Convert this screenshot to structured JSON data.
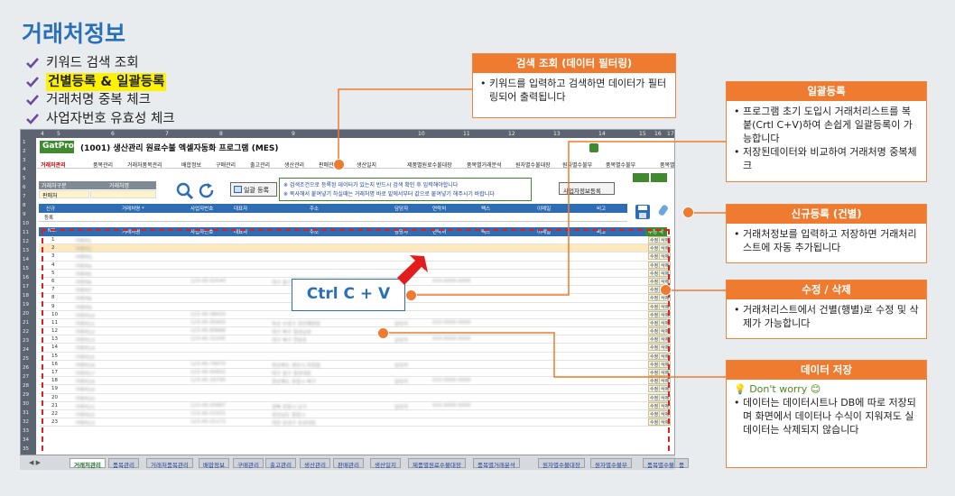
{
  "page": {
    "title": "거래처정보",
    "features": [
      {
        "label": "키워드 검색 조회",
        "highlight": false
      },
      {
        "label": "건별등록 & 일괄등록",
        "highlight": true
      },
      {
        "label": "거래처명 중복 체크",
        "highlight": false
      },
      {
        "label": "사업자번호 유효성 체크",
        "highlight": false
      }
    ]
  },
  "sheet": {
    "logo": "GatPro",
    "program_title": "(1001) 생산관리 원료수불 엑셀자동화 프로그램 (MES)",
    "col_headers": [
      "4",
      "5",
      "6",
      "7",
      "8",
      "9",
      "10",
      "11",
      "12",
      "13",
      "14",
      "15",
      "16",
      "17"
    ],
    "menu": [
      "거래처관리",
      "품목관리",
      "거래처품목관리",
      "배합정보",
      "구매관리",
      "출고관리",
      "생산관리",
      "판매관리",
      "생산일지",
      "제품별원료수불대장",
      "품목별거래분석",
      "원자별수불대장",
      "원자별수불부",
      "품목별수불부",
      "품목별"
    ],
    "search": {
      "label": "거래처구분",
      "label2": "거래처명",
      "value": "판매처"
    },
    "bulk_button": "일괄 등록",
    "notice": [
      "※ 검색조건으로 등록된 데이터가 있는지 반드시 검색 확인 후 입력해야합니다",
      "※ 복사해서 붙여넣기 하실때는 거래처명 바로 밑에서부터 값으로 붙여넣기 해주시기 바랍니다"
    ],
    "check_button": "사업자정보등록",
    "input_headers": [
      "신규",
      "거래처명 *",
      "사업자번호",
      "대표자",
      "주소",
      "담당자",
      "연락처",
      "팩스",
      "이메일",
      "비고"
    ],
    "input_row_label": "등록",
    "grid_headers": [
      "NO.",
      "거래처명",
      "사업자번호",
      "대표자",
      "주소",
      "담당자",
      "연락처",
      "팩스",
      "이메일",
      "비고",
      "수정",
      "삭제"
    ],
    "rows": [
      {
        "no": "1",
        "name": "거래처1",
        "biz": "",
        "rep": "",
        "addr": "",
        "mgr": "",
        "tel": ""
      },
      {
        "no": "2",
        "name": "거래처2",
        "biz": "",
        "rep": "",
        "addr": "",
        "mgr": "",
        "tel": ""
      },
      {
        "no": "3",
        "name": "거래처3",
        "biz": "",
        "rep": "",
        "addr": "",
        "mgr": "",
        "tel": ""
      },
      {
        "no": "4",
        "name": "거래처4",
        "biz": "",
        "rep": "",
        "addr": "",
        "mgr": "",
        "tel": ""
      },
      {
        "no": "5",
        "name": "거래처5",
        "biz": "",
        "rep": "",
        "addr": "",
        "mgr": "",
        "tel": ""
      },
      {
        "no": "6",
        "name": "거래처6",
        "biz": "123-45-02540",
        "rep": "",
        "addr": "대구 중구 동성로",
        "mgr": "",
        "tel": "010-0000-0000"
      },
      {
        "no": "7",
        "name": "거래처7",
        "biz": "",
        "rep": "",
        "addr": "",
        "mgr": "",
        "tel": ""
      },
      {
        "no": "8",
        "name": "거래처8",
        "biz": "",
        "rep": "",
        "addr": "",
        "mgr": "",
        "tel": ""
      },
      {
        "no": "9",
        "name": "거래처9",
        "biz": "",
        "rep": "",
        "addr": "",
        "mgr": "",
        "tel": ""
      },
      {
        "no": "10",
        "name": "거래처10",
        "biz": "123-45-08420",
        "rep": "",
        "addr": "",
        "mgr": "",
        "tel": ""
      },
      {
        "no": "11",
        "name": "거래처11",
        "biz": "123-45-00455",
        "rep": "",
        "addr": "부산 수영구 광안해변로",
        "mgr": "담당자",
        "tel": "010-0000-0000"
      },
      {
        "no": "12",
        "name": "거래처12",
        "biz": "123-45-89888",
        "rep": "",
        "addr": "대구 북구 칠성남로",
        "mgr": "",
        "tel": ""
      },
      {
        "no": "13",
        "name": "거래처13",
        "biz": "123-45-32245",
        "rep": "",
        "addr": "대구 북구 연암로",
        "mgr": "담당자",
        "tel": "010-0000-0000"
      },
      {
        "no": "14",
        "name": "거래처14",
        "biz": "",
        "rep": "",
        "addr": "",
        "mgr": "",
        "tel": ""
      },
      {
        "no": "15",
        "name": "거래처15",
        "biz": "",
        "rep": "",
        "addr": "",
        "mgr": "",
        "tel": ""
      },
      {
        "no": "16",
        "name": "거래처16",
        "biz": "123-45-79070",
        "rep": "",
        "addr": "경상북도 경산시 하양읍",
        "mgr": "담당자",
        "tel": ""
      },
      {
        "no": "17",
        "name": "거래처17",
        "biz": "123-45-00832",
        "rep": "",
        "addr": "대구 중구 중앙대로",
        "mgr": "",
        "tel": ""
      },
      {
        "no": "18",
        "name": "거래처18",
        "biz": "123-45-16745",
        "rep": "",
        "addr": "경상북도 포항시 북구",
        "mgr": "담당자",
        "tel": "010-0000-0000"
      },
      {
        "no": "19",
        "name": "거래처19",
        "biz": "",
        "rep": "",
        "addr": "",
        "mgr": "",
        "tel": ""
      },
      {
        "no": "20",
        "name": "거래처20",
        "biz": "",
        "rep": "",
        "addr": "",
        "mgr": "",
        "tel": ""
      },
      {
        "no": "21",
        "name": "거래처21",
        "biz": "123-45-00887",
        "rep": "",
        "addr": "경북 포항시 남구",
        "mgr": "담당자",
        "tel": "010-0000-0000"
      },
      {
        "no": "22",
        "name": "거래처22",
        "biz": "123-45-01501",
        "rep": "",
        "addr": "경상남도 창원시",
        "mgr": "",
        "tel": ""
      },
      {
        "no": "23",
        "name": "거래처23",
        "biz": "123-45-01172",
        "rep": "",
        "addr": "대전 유성구 유성대로",
        "mgr": "",
        "tel": ""
      }
    ],
    "edit_label": "수정",
    "delete_label": "삭제",
    "tabs": [
      "거래처관리",
      "품목관리",
      "거래처품목관리",
      "배합정보",
      "구매관리",
      "출고관리",
      "생산관리",
      "판매관리",
      "생산일지",
      "제품별원료수불대장",
      "품목별거래분석",
      "원자별수불대장",
      "원자별수불부",
      "품목별수불부",
      "품"
    ],
    "active_tab": 0
  },
  "overlay": {
    "ctrlcv": "Ctrl C + V"
  },
  "callouts": {
    "search": {
      "title": "검색 조회 (데이터 필터링)",
      "items": [
        "키워드를 입력하고 검색하면 데이터가 필터링되어 출력됩니다"
      ]
    },
    "bulk": {
      "title": "일괄등록",
      "items": [
        "프로그램 초기 도입시 거래처리스트를 복붙(Crtl C+V)하여 손쉽게 일괄등록이 가능합니다",
        "저장된데이터와 비교하여 거래처명 중복체크"
      ]
    },
    "new": {
      "title": "신규등록 (건별)",
      "items": [
        "거래처정보를 입력하고 저장하면 거래처리스트에 자동 추가됩니다"
      ]
    },
    "edit": {
      "title": "수정 / 삭제",
      "items": [
        "거래처리스트에서 건별(행별)로 수정 및 삭제가 가능합니다"
      ]
    },
    "save": {
      "title": "데이터 저장",
      "tip": "💡 Don't worry 😊",
      "items": [
        "데이터는 데이터시트나 DB에 따로 저장되며 화면에서 데이터나 수식이 지워져도 실데이터는 삭제되지 않습니다"
      ]
    }
  },
  "colors": {
    "accent": "#2970b8",
    "callout": "#ee7b2f",
    "highlight": "#fff200",
    "sheet_header": "#2e6cb3",
    "green": "#3f8a2e"
  }
}
